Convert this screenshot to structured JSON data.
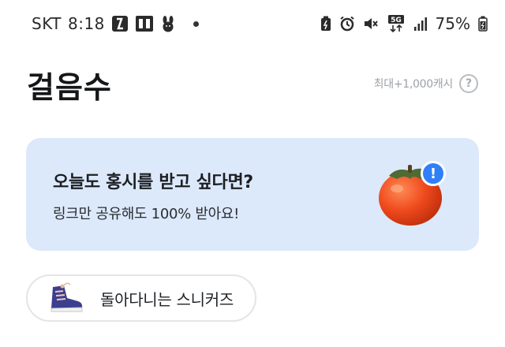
{
  "status_bar": {
    "carrier": "SKT",
    "time": "8:18",
    "network": "5G",
    "battery": "75%",
    "icons": [
      "app-icon",
      "app-icon-2",
      "rabbit-icon",
      "notification-dot",
      "battery-saver-icon",
      "alarm-icon",
      "mute-icon",
      "5g-icon",
      "signal-icon",
      "battery-icon"
    ]
  },
  "header": {
    "title": "걸음수",
    "max_reward": "최대+1,000캐시",
    "help_symbol": "?"
  },
  "banner": {
    "title": "오늘도 홍시를 받고 싶다면?",
    "subtitle": "링크만 공유해도 100% 받아요!",
    "badge_symbol": "!",
    "colors": {
      "background": "#dce9fb",
      "badge": "#2f7ff7",
      "persimmon": "#ef4a1d"
    }
  },
  "chip": {
    "label": "돌아다니는 스니커즈",
    "icon": "sneaker-icon"
  }
}
